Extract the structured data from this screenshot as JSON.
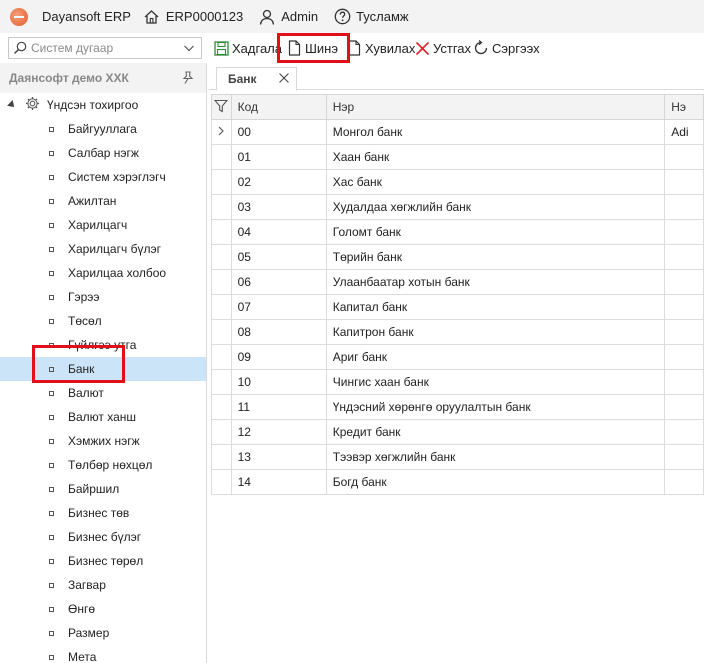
{
  "topbar": {
    "app_name": "Dayansoft ERP",
    "home_label": "ERP0000123",
    "user_label": "Admin",
    "help_label": "Тусламж"
  },
  "toolbar": {
    "search_placeholder": "Систем дугаар",
    "save_label": "Хадгала",
    "new_label": "Шинэ",
    "copy_label": "Хувилах",
    "delete_label": "Устгах",
    "refresh_label": "Сэргээх"
  },
  "sidebar": {
    "company": "Даянсофт демо ХХК",
    "root_label": "Үндсэн тохиргоо",
    "items": [
      {
        "label": "Байгууллага"
      },
      {
        "label": "Салбар нэгж"
      },
      {
        "label": "Систем хэрэглэгч"
      },
      {
        "label": "Ажилтан"
      },
      {
        "label": "Харилцагч"
      },
      {
        "label": "Харилцагч бүлэг"
      },
      {
        "label": "Харилцаа холбоо"
      },
      {
        "label": "Гэрээ"
      },
      {
        "label": "Төсөл"
      },
      {
        "label": "Гүйлгээ утга"
      },
      {
        "label": "Банк",
        "selected": true
      },
      {
        "label": "Валют"
      },
      {
        "label": "Валют ханш"
      },
      {
        "label": "Хэмжих нэгж"
      },
      {
        "label": "Төлбөр нөхцөл"
      },
      {
        "label": "Байршил"
      },
      {
        "label": "Бизнес төв"
      },
      {
        "label": "Бизнес бүлэг"
      },
      {
        "label": "Бизнес төрөл"
      },
      {
        "label": "Загвар"
      },
      {
        "label": "Өнгө"
      },
      {
        "label": "Размер"
      },
      {
        "label": "Мета"
      }
    ]
  },
  "tab": {
    "label": "Банк"
  },
  "grid": {
    "columns": [
      "Код",
      "Нэр",
      "Нэ"
    ],
    "rows": [
      {
        "code": "00",
        "name": "Монгол банк",
        "extra": "Adi"
      },
      {
        "code": "01",
        "name": "Хаан банк",
        "extra": ""
      },
      {
        "code": "02",
        "name": "Хас банк",
        "extra": ""
      },
      {
        "code": "03",
        "name": "Худалдаа хөгжлийн банк",
        "extra": ""
      },
      {
        "code": "04",
        "name": "Голомт банк",
        "extra": ""
      },
      {
        "code": "05",
        "name": "Төрийн банк",
        "extra": ""
      },
      {
        "code": "06",
        "name": "Улаанбаатар хотын банк",
        "extra": ""
      },
      {
        "code": "07",
        "name": "Капитал банк",
        "extra": ""
      },
      {
        "code": "08",
        "name": "Капитрон банк",
        "extra": ""
      },
      {
        "code": "09",
        "name": "Ариг банк",
        "extra": ""
      },
      {
        "code": "10",
        "name": "Чингис хаан банк",
        "extra": ""
      },
      {
        "code": "11",
        "name": "Үндэсний хөрөнгө оруулалтын банк",
        "extra": ""
      },
      {
        "code": "12",
        "name": "Кредит банк",
        "extra": ""
      },
      {
        "code": "13",
        "name": "Тээвэр хөгжлийн банк",
        "extra": ""
      },
      {
        "code": "14",
        "name": "Богд банк",
        "extra": ""
      }
    ]
  },
  "colors": {
    "highlight_box": "#e0101a",
    "selected_row": "#cce4f7",
    "save_icon": "#2e8b3a",
    "delete_icon": "#d9252b"
  }
}
